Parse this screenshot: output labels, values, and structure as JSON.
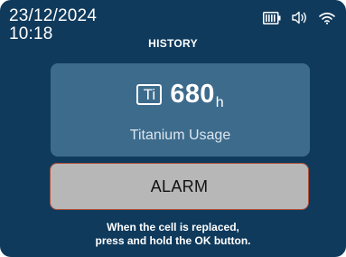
{
  "status_bar": {
    "date": "23/12/2024",
    "time": "10:18",
    "icons": [
      "battery-icon",
      "speaker-icon",
      "wifi-icon"
    ]
  },
  "screen_title": "HISTORY",
  "usage": {
    "icon_label": "Ti",
    "value": "680",
    "unit": "h",
    "label": "Titanium Usage"
  },
  "alarm_button": {
    "label": "ALARM"
  },
  "instructions": {
    "line1": "When the cell is replaced,",
    "line2": "press and hold the OK button."
  },
  "colors": {
    "background": "#0f3a5c",
    "panel": "#3d6b8c",
    "button": "#b7b7b7",
    "button_border": "#b24f3a"
  }
}
